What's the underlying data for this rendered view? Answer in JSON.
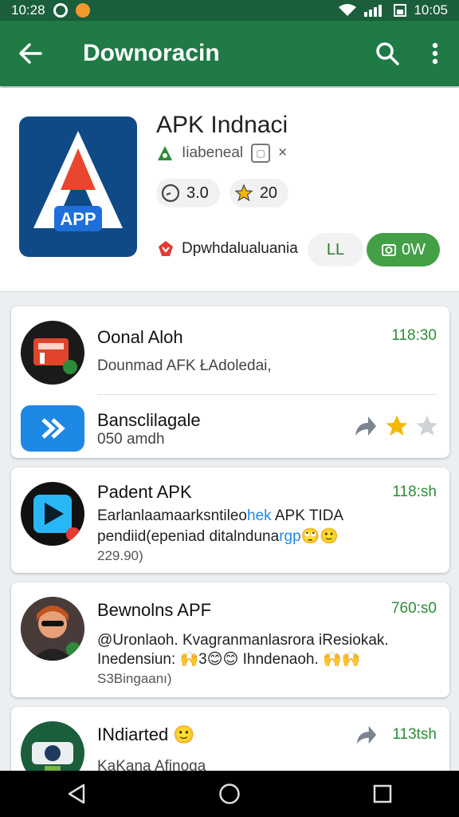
{
  "status_bar": {
    "time_left": "10:28",
    "time_right": "10:05"
  },
  "app_bar": {
    "title": "Downoracin"
  },
  "app": {
    "name": "APK Indnaci",
    "developer": "Iiabeneal",
    "dev_badge": "×",
    "icon_text": "APP",
    "rating": "3.0",
    "stars": "20",
    "download_label": "Dpwhdalualuania",
    "secondary_button": "LL",
    "primary_button": "0W"
  },
  "cards": [
    {
      "rows": [
        {
          "title": "Oonal Aloh",
          "subtitle": "Dounmad AFK ŁAdoledai,",
          "time": "118:30"
        },
        {
          "title": "Bansclilagale",
          "subtitle": "050 amdh"
        }
      ]
    },
    {
      "title": "Padent APK",
      "time": "118:sh",
      "line1_a": "Earlanlaamaarksntileo",
      "line1_b": "hek",
      "line1_c": " APK TIDA",
      "line2_a": "pendiid(epeniad ditalnduna",
      "line2_b": "rgp",
      "line2_c": "🙄🙂",
      "line3": "229.90)"
    },
    {
      "title": "Bewnolns APF",
      "time": "760:s0",
      "line1": "@Uronlaoh. Kvagranmanlasrora iResiokak.",
      "line2": "Inedensiun: 🙌3😊😊 Ihndenaoh. 🙌🙌",
      "line3": "S3Bingaanı)"
    },
    {
      "title": "INdiarted 🙂",
      "time": "113tsh",
      "subtitle": "KaKana Afinoga"
    }
  ],
  "colors": {
    "primary": "#1f7a45",
    "status": "#1b5e3b",
    "accent": "#43a047",
    "star": "#f5b800"
  }
}
